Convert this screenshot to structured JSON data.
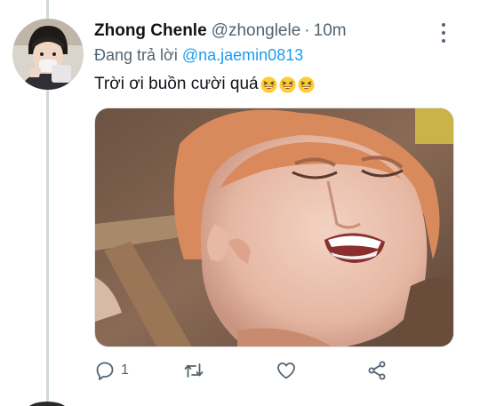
{
  "tweet": {
    "display_name": "Zhong Chenle",
    "handle": "@zhonglele",
    "separator": "·",
    "time": "10m",
    "reply_prefix": "Đang trả lời",
    "reply_mention": "@na.jaemin0813",
    "text": "Trời ơi buồn cười quá",
    "emojis": [
      "grinning-squinting-face",
      "grinning-squinting-face",
      "grinning-squinting-face"
    ]
  },
  "actions": {
    "reply_count": "1",
    "retweet_count": "",
    "like_count": "",
    "icons": [
      "reply-icon",
      "retweet-icon",
      "like-icon",
      "share-icon"
    ]
  },
  "colors": {
    "text_primary": "#0f1419",
    "text_secondary": "#536471",
    "link": "#1d9bf0",
    "thread_line": "#cfd9de"
  }
}
